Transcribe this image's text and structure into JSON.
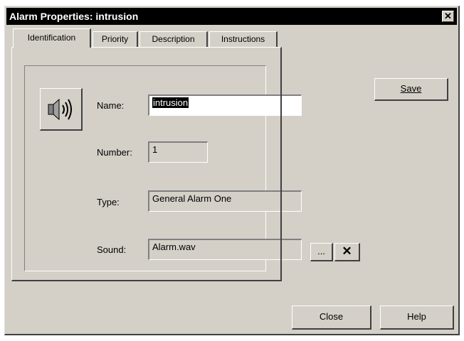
{
  "window": {
    "title": "Alarm Properties: intrusion"
  },
  "tabs": [
    {
      "label": "Identification",
      "active": true
    },
    {
      "label": "Priority",
      "active": false
    },
    {
      "label": "Description",
      "active": false
    },
    {
      "label": "Instructions",
      "active": false
    }
  ],
  "form": {
    "icon": "speaker-icon",
    "name_label": "Name:",
    "name_value": "intrusion",
    "number_label": "Number:",
    "number_value": "1",
    "type_label": "Type:",
    "type_value": "General Alarm One",
    "sound_label": "Sound:",
    "sound_value": "Alarm.wav",
    "browse_label": "...",
    "clear_label": "✕"
  },
  "buttons": {
    "save_label": "Save",
    "close_label": "Close",
    "help_label": "Help"
  },
  "colors": {
    "face": "#d4d0c8",
    "titlebar": "#000000",
    "selection": "#000000"
  }
}
